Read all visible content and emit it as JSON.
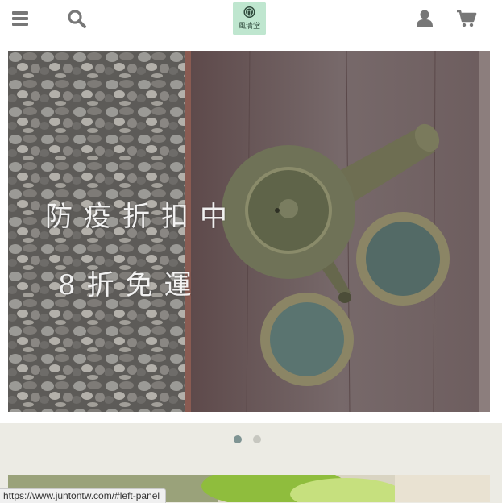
{
  "header": {
    "menu_icon": "menu-icon",
    "search_icon": "search-icon",
    "logo_text": "風清堂",
    "account_icon": "user-icon",
    "cart_icon": "cart-icon"
  },
  "hero": {
    "caption_line1": "防疫折扣中",
    "caption_line2": "8折免運",
    "slides": [
      {
        "active": true
      },
      {
        "active": false
      }
    ]
  },
  "status_bar": {
    "url": "https://www.juntontw.com/#left-panel"
  },
  "colors": {
    "header_bg": "#ffffff",
    "page_bg": "#ecebe4",
    "icon": "#777777",
    "logo_bg": "#bfe6cf",
    "dot_active": "#7f9493",
    "dot_inactive": "#c7c7c0"
  }
}
